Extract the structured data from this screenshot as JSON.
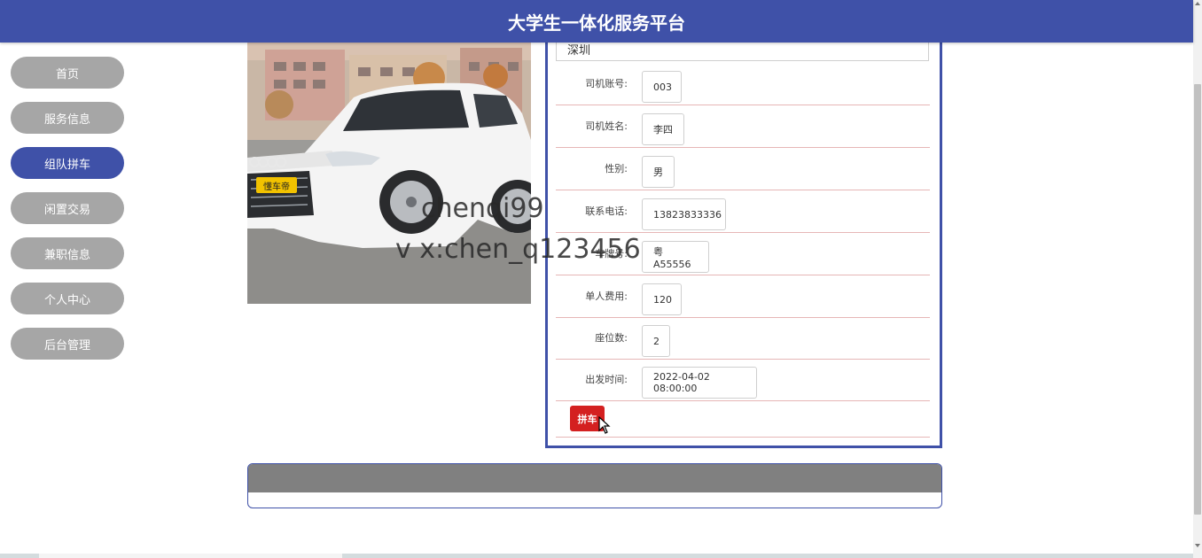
{
  "header": {
    "title": "大学生一体化服务平台"
  },
  "sidebar": {
    "items": [
      {
        "label": "首页",
        "active": false
      },
      {
        "label": "服务信息",
        "active": false
      },
      {
        "label": "组队拼车",
        "active": true
      },
      {
        "label": "闲置交易",
        "active": false
      },
      {
        "label": "兼职信息",
        "active": false
      },
      {
        "label": "个人中心",
        "active": false
      },
      {
        "label": "后台管理",
        "active": false
      }
    ]
  },
  "detail": {
    "destination": "深圳",
    "fields": [
      {
        "label": "司机账号:",
        "value": "003"
      },
      {
        "label": "司机姓名:",
        "value": "李四"
      },
      {
        "label": "性别:",
        "value": "男"
      },
      {
        "label": "联系电话:",
        "value": "13823833336"
      },
      {
        "label": "车牌号:",
        "value": "粤A55556"
      },
      {
        "label": "单人费用:",
        "value": "120"
      },
      {
        "label": "座位数:",
        "value": "2"
      },
      {
        "label": "出发时间:",
        "value": "2022-04-02 08:00:00"
      }
    ],
    "carpool_button": "拼车"
  },
  "car_image": {
    "plate_badge": "懂车帝"
  },
  "watermark": {
    "line1": "chenqi99",
    "line2": "v x:chen_q123456"
  },
  "colors": {
    "primary": "#3f51a8",
    "inactive": "#a6a6a6",
    "button_red": "#d42020",
    "row_divider": "#e6b6b6"
  }
}
